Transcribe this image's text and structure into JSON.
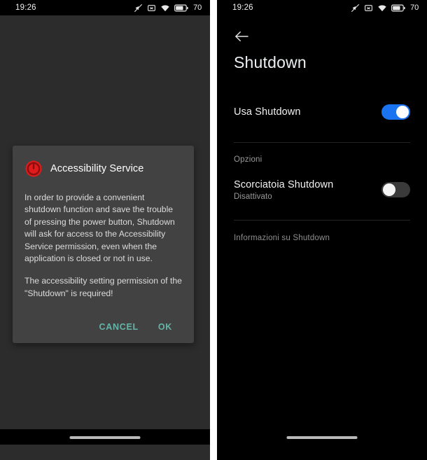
{
  "statusbar": {
    "time": "19:26",
    "battery_percent": "70",
    "icons": [
      "mute-icon",
      "alarm-off-icon",
      "wifi-icon",
      "battery-icon"
    ]
  },
  "left_screen": {
    "dialog": {
      "icon": "power-icon",
      "title": "Accessibility Service",
      "paragraphs": [
        "In order to provide a convenient shutdown function and save the trouble of pressing the power button, Shutdown will ask for access to the Accessibility Service permission, even when the application is closed or not in use.",
        "The accessibility setting permission of the \"Shutdown\" is required!"
      ],
      "cancel_label": "CANCEL",
      "ok_label": "OK",
      "accent_color": "#64b5a8",
      "surface_color": "#424242"
    }
  },
  "right_screen": {
    "back_icon": "arrow-left-icon",
    "title": "Shutdown",
    "main_pref": {
      "title": "Usa Shutdown",
      "toggle_state": "on"
    },
    "section_label": "Opzioni",
    "shortcut_pref": {
      "title": "Scorciatoia Shutdown",
      "subtitle": "Disattivato",
      "toggle_state": "off"
    },
    "about_label": "Informazioni su Shutdown",
    "toggle_on_color": "#1a73f0",
    "toggle_off_color": "#3a3a3a"
  }
}
